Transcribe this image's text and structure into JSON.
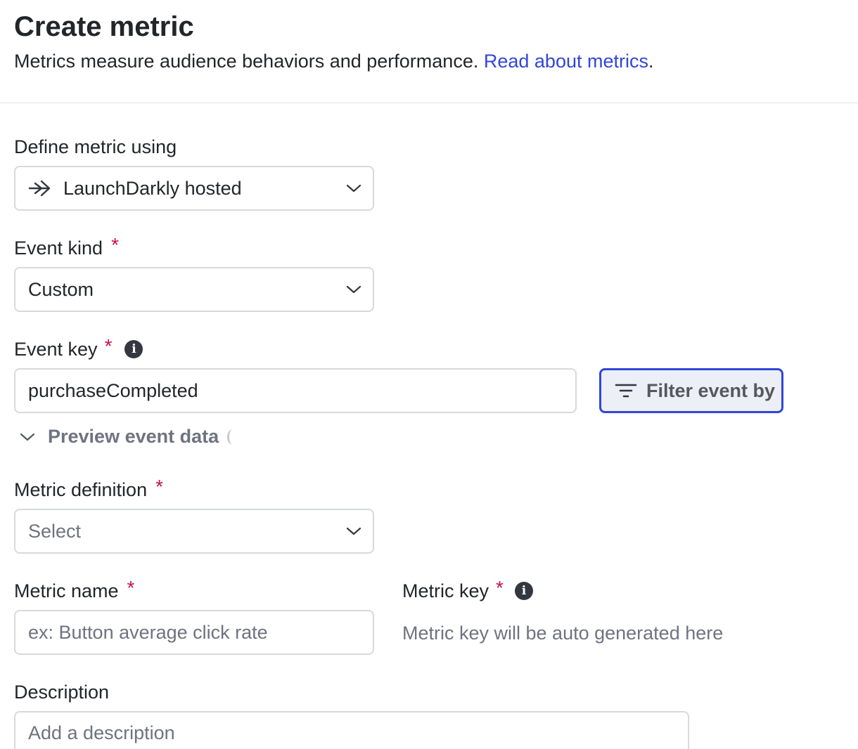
{
  "header": {
    "title": "Create metric",
    "subtitle": "Metrics measure audience behaviors and performance.",
    "link_text": "Read about metrics",
    "link_suffix": "."
  },
  "define_metric": {
    "label": "Define metric using",
    "value": "LaunchDarkly hosted",
    "icon": "arrow-right-icon"
  },
  "event_kind": {
    "label": "Event kind",
    "required_marker": "*",
    "value": "Custom"
  },
  "event_key": {
    "label": "Event key",
    "required_marker": "*",
    "value": "purchaseCompleted",
    "filter_button_label": "Filter event by"
  },
  "preview": {
    "label": "Preview event data"
  },
  "metric_definition": {
    "label": "Metric definition",
    "required_marker": "*",
    "placeholder": "Select"
  },
  "metric_name": {
    "label": "Metric name",
    "required_marker": "*",
    "placeholder": "ex: Button average click rate"
  },
  "metric_key": {
    "label": "Metric key",
    "required_marker": "*",
    "placeholder": "Metric key will be auto generated here"
  },
  "description": {
    "label": "Description",
    "placeholder": "Add a description"
  },
  "colors": {
    "link": "#3046d9",
    "required": "#c4124f",
    "focus_border": "#3046d9",
    "border": "#d7d9de"
  }
}
